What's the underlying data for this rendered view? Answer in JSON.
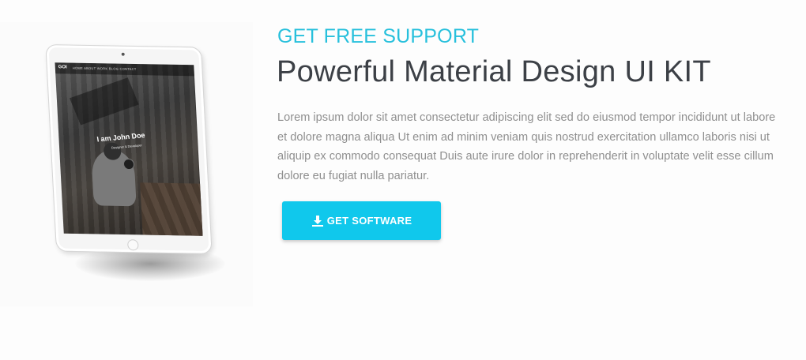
{
  "hero": {
    "eyebrow": "GET FREE SUPPORT",
    "headline": "Powerful Material Design UI KIT",
    "body": "Lorem ipsum dolor sit amet consectetur adipiscing elit sed do eiusmod tempor incididunt ut labore et dolore magna aliqua Ut enim ad minim veniam quis nostrud exercitation ullamco laboris nisi ut aliquip ex commodo consequat Duis aute irure dolor in reprehenderit in voluptate velit esse cillum dolore eu fugiat nulla pariatur.",
    "button_label": "GET SOFTWARE",
    "button_icon": "download-icon"
  },
  "tablet": {
    "screen_logo": "GOI",
    "screen_menu": "HOME ABOUT WORK BLOG CONTACT",
    "screen_title": "I am John Doe",
    "screen_subtitle": "Designer & Developer"
  },
  "colors": {
    "accent": "#27c0dc",
    "button": "#10c8ec",
    "headline": "#3c4046",
    "body": "#8f8f8f"
  }
}
